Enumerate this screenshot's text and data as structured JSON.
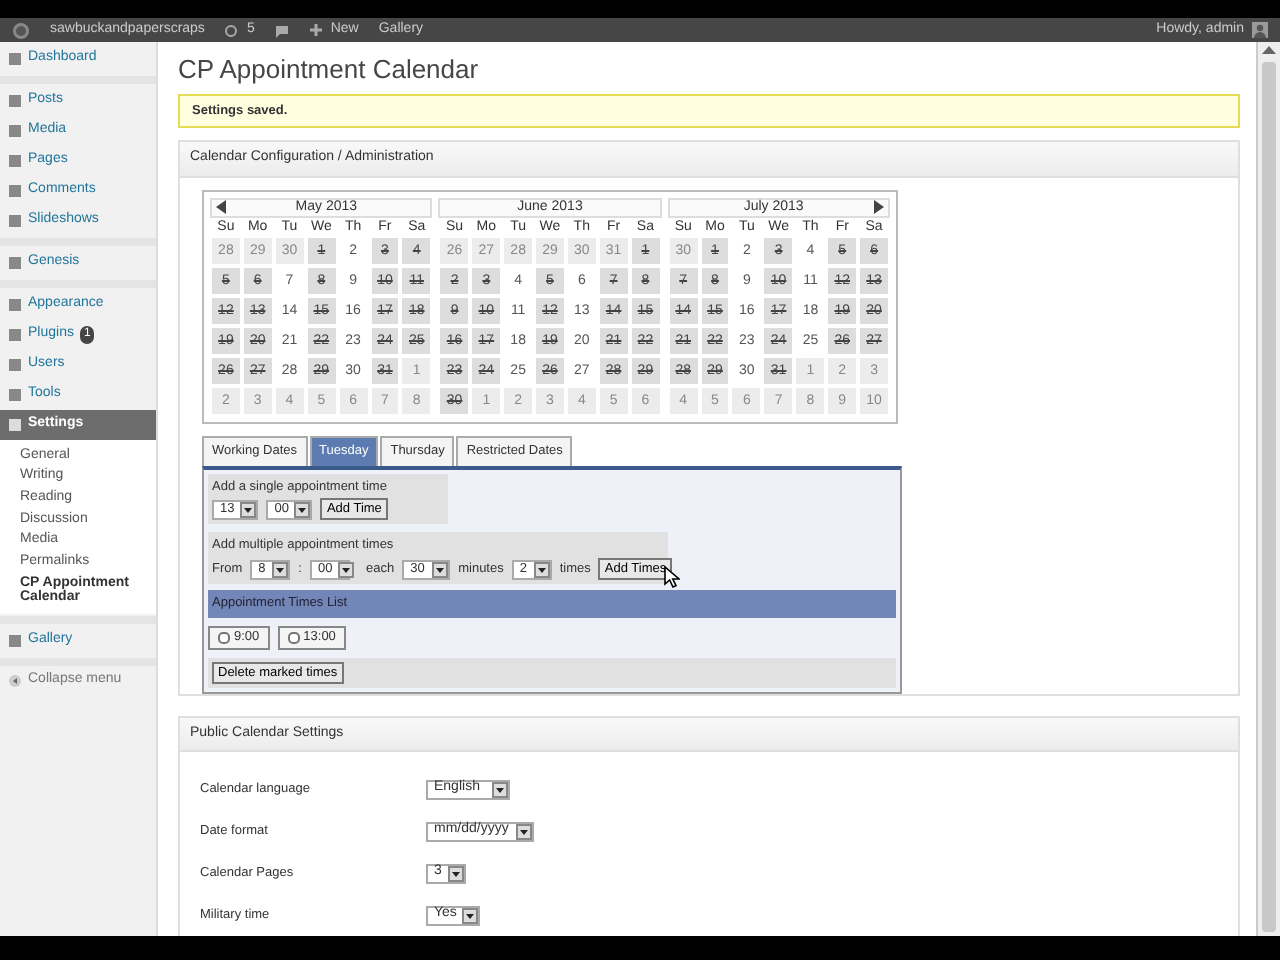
{
  "admin_bar": {
    "site_name": "sawbuckandpaperscraps",
    "updates": "5",
    "new_label": "New",
    "gallery": "Gallery",
    "greeting": "Howdy, admin"
  },
  "sidebar": {
    "groups": [
      [
        {
          "label": "Dashboard",
          "selected": false
        }
      ],
      [
        {
          "label": "Posts",
          "selected": false
        },
        {
          "label": "Media",
          "selected": false
        },
        {
          "label": "Pages",
          "selected": false
        },
        {
          "label": "Comments",
          "selected": false
        },
        {
          "label": "Slideshows",
          "selected": false
        }
      ],
      [
        {
          "label": "Genesis",
          "selected": false
        }
      ],
      [
        {
          "label": "Appearance",
          "selected": false
        },
        {
          "label": "Plugins",
          "selected": false,
          "badge": "1"
        },
        {
          "label": "Users",
          "selected": false
        },
        {
          "label": "Tools",
          "selected": false
        },
        {
          "label": "Settings",
          "selected": true,
          "children": [
            {
              "label": "General",
              "selected": false
            },
            {
              "label": "Writing",
              "selected": false
            },
            {
              "label": "Reading",
              "selected": false
            },
            {
              "label": "Discussion",
              "selected": false
            },
            {
              "label": "Media",
              "selected": false
            },
            {
              "label": "Permalinks",
              "selected": false
            },
            {
              "label": "CP Appointment Calendar",
              "selected": true
            }
          ]
        }
      ],
      [
        {
          "label": "Gallery",
          "selected": false
        }
      ]
    ],
    "collapse": "Collapse menu"
  },
  "page": {
    "title": "CP Appointment Calendar",
    "notice": "Settings saved.",
    "config_title": "Calendar Configuration / Administration"
  },
  "calendar": {
    "months": [
      {
        "title": "May 2013",
        "weekdays": [
          "Su",
          "Mo",
          "Tu",
          "We",
          "Th",
          "Fr",
          "Sa"
        ],
        "weeks": [
          [
            {
              "day": "28",
              "blocked": false,
              "outside_month": true
            },
            {
              "day": "29",
              "blocked": false,
              "outside_month": true
            },
            {
              "day": "30",
              "blocked": false,
              "outside_month": true
            },
            {
              "day": "1",
              "blocked": true,
              "outside_month": false
            },
            {
              "day": "2",
              "blocked": false,
              "outside_month": false
            },
            {
              "day": "3",
              "blocked": true,
              "outside_month": false
            },
            {
              "day": "4",
              "blocked": true,
              "outside_month": false
            }
          ],
          [
            {
              "day": "5",
              "blocked": true,
              "outside_month": false
            },
            {
              "day": "6",
              "blocked": true,
              "outside_month": false
            },
            {
              "day": "7",
              "blocked": false,
              "outside_month": false
            },
            {
              "day": "8",
              "blocked": true,
              "outside_month": false
            },
            {
              "day": "9",
              "blocked": false,
              "outside_month": false
            },
            {
              "day": "10",
              "blocked": true,
              "outside_month": false
            },
            {
              "day": "11",
              "blocked": true,
              "outside_month": false
            }
          ],
          [
            {
              "day": "12",
              "blocked": true,
              "outside_month": false
            },
            {
              "day": "13",
              "blocked": true,
              "outside_month": false
            },
            {
              "day": "14",
              "blocked": false,
              "outside_month": false
            },
            {
              "day": "15",
              "blocked": true,
              "outside_month": false
            },
            {
              "day": "16",
              "blocked": false,
              "outside_month": false
            },
            {
              "day": "17",
              "blocked": true,
              "outside_month": false
            },
            {
              "day": "18",
              "blocked": true,
              "outside_month": false
            }
          ],
          [
            {
              "day": "19",
              "blocked": true,
              "outside_month": false
            },
            {
              "day": "20",
              "blocked": true,
              "outside_month": false
            },
            {
              "day": "21",
              "blocked": false,
              "outside_month": false
            },
            {
              "day": "22",
              "blocked": true,
              "outside_month": false
            },
            {
              "day": "23",
              "blocked": false,
              "outside_month": false
            },
            {
              "day": "24",
              "blocked": true,
              "outside_month": false
            },
            {
              "day": "25",
              "blocked": true,
              "outside_month": false
            }
          ],
          [
            {
              "day": "26",
              "blocked": true,
              "outside_month": false
            },
            {
              "day": "27",
              "blocked": true,
              "outside_month": false
            },
            {
              "day": "28",
              "blocked": false,
              "outside_month": false
            },
            {
              "day": "29",
              "blocked": true,
              "outside_month": false
            },
            {
              "day": "30",
              "blocked": false,
              "outside_month": false
            },
            {
              "day": "31",
              "blocked": true,
              "outside_month": false
            },
            {
              "day": "1",
              "blocked": false,
              "outside_month": true
            }
          ],
          [
            {
              "day": "2",
              "blocked": false,
              "outside_month": true
            },
            {
              "day": "3",
              "blocked": false,
              "outside_month": true
            },
            {
              "day": "4",
              "blocked": false,
              "outside_month": true
            },
            {
              "day": "5",
              "blocked": false,
              "outside_month": true
            },
            {
              "day": "6",
              "blocked": false,
              "outside_month": true
            },
            {
              "day": "7",
              "blocked": false,
              "outside_month": true
            },
            {
              "day": "8",
              "blocked": false,
              "outside_month": true
            }
          ]
        ]
      },
      {
        "title": "June 2013",
        "weekdays": [
          "Su",
          "Mo",
          "Tu",
          "We",
          "Th",
          "Fr",
          "Sa"
        ],
        "weeks": [
          [
            {
              "day": "26",
              "blocked": false,
              "outside_month": true
            },
            {
              "day": "27",
              "blocked": false,
              "outside_month": true
            },
            {
              "day": "28",
              "blocked": false,
              "outside_month": true
            },
            {
              "day": "29",
              "blocked": false,
              "outside_month": true
            },
            {
              "day": "30",
              "blocked": false,
              "outside_month": true
            },
            {
              "day": "31",
              "blocked": false,
              "outside_month": true
            },
            {
              "day": "1",
              "blocked": true,
              "outside_month": false
            }
          ],
          [
            {
              "day": "2",
              "blocked": true,
              "outside_month": false
            },
            {
              "day": "3",
              "blocked": true,
              "outside_month": false
            },
            {
              "day": "4",
              "blocked": false,
              "outside_month": false
            },
            {
              "day": "5",
              "blocked": true,
              "outside_month": false
            },
            {
              "day": "6",
              "blocked": false,
              "outside_month": false
            },
            {
              "day": "7",
              "blocked": true,
              "outside_month": false
            },
            {
              "day": "8",
              "blocked": true,
              "outside_month": false
            }
          ],
          [
            {
              "day": "9",
              "blocked": true,
              "outside_month": false
            },
            {
              "day": "10",
              "blocked": true,
              "outside_month": false
            },
            {
              "day": "11",
              "blocked": false,
              "outside_month": false
            },
            {
              "day": "12",
              "blocked": true,
              "outside_month": false
            },
            {
              "day": "13",
              "blocked": false,
              "outside_month": false
            },
            {
              "day": "14",
              "blocked": true,
              "outside_month": false
            },
            {
              "day": "15",
              "blocked": true,
              "outside_month": false
            }
          ],
          [
            {
              "day": "16",
              "blocked": true,
              "outside_month": false
            },
            {
              "day": "17",
              "blocked": true,
              "outside_month": false
            },
            {
              "day": "18",
              "blocked": false,
              "outside_month": false
            },
            {
              "day": "19",
              "blocked": true,
              "outside_month": false
            },
            {
              "day": "20",
              "blocked": false,
              "outside_month": false
            },
            {
              "day": "21",
              "blocked": true,
              "outside_month": false
            },
            {
              "day": "22",
              "blocked": true,
              "outside_month": false
            }
          ],
          [
            {
              "day": "23",
              "blocked": true,
              "outside_month": false
            },
            {
              "day": "24",
              "blocked": true,
              "outside_month": false
            },
            {
              "day": "25",
              "blocked": false,
              "outside_month": false
            },
            {
              "day": "26",
              "blocked": true,
              "outside_month": false
            },
            {
              "day": "27",
              "blocked": false,
              "outside_month": false
            },
            {
              "day": "28",
              "blocked": true,
              "outside_month": false
            },
            {
              "day": "29",
              "blocked": true,
              "outside_month": false
            }
          ],
          [
            {
              "day": "30",
              "blocked": true,
              "outside_month": false
            },
            {
              "day": "1",
              "blocked": false,
              "outside_month": true
            },
            {
              "day": "2",
              "blocked": false,
              "outside_month": true
            },
            {
              "day": "3",
              "blocked": false,
              "outside_month": true
            },
            {
              "day": "4",
              "blocked": false,
              "outside_month": true
            },
            {
              "day": "5",
              "blocked": false,
              "outside_month": true
            },
            {
              "day": "6",
              "blocked": false,
              "outside_month": true
            }
          ]
        ]
      },
      {
        "title": "July 2013",
        "weekdays": [
          "Su",
          "Mo",
          "Tu",
          "We",
          "Th",
          "Fr",
          "Sa"
        ],
        "weeks": [
          [
            {
              "day": "30",
              "blocked": false,
              "outside_month": true
            },
            {
              "day": "1",
              "blocked": true,
              "outside_month": false
            },
            {
              "day": "2",
              "blocked": false,
              "outside_month": false
            },
            {
              "day": "3",
              "blocked": true,
              "outside_month": false
            },
            {
              "day": "4",
              "blocked": false,
              "outside_month": false
            },
            {
              "day": "5",
              "blocked": true,
              "outside_month": false
            },
            {
              "day": "6",
              "blocked": true,
              "outside_month": false
            }
          ],
          [
            {
              "day": "7",
              "blocked": true,
              "outside_month": false
            },
            {
              "day": "8",
              "blocked": true,
              "outside_month": false
            },
            {
              "day": "9",
              "blocked": false,
              "outside_month": false
            },
            {
              "day": "10",
              "blocked": true,
              "outside_month": false
            },
            {
              "day": "11",
              "blocked": false,
              "outside_month": false
            },
            {
              "day": "12",
              "blocked": true,
              "outside_month": false
            },
            {
              "day": "13",
              "blocked": true,
              "outside_month": false
            }
          ],
          [
            {
              "day": "14",
              "blocked": true,
              "outside_month": false
            },
            {
              "day": "15",
              "blocked": true,
              "outside_month": false
            },
            {
              "day": "16",
              "blocked": false,
              "outside_month": false
            },
            {
              "day": "17",
              "blocked": true,
              "outside_month": false
            },
            {
              "day": "18",
              "blocked": false,
              "outside_month": false
            },
            {
              "day": "19",
              "blocked": true,
              "outside_month": false
            },
            {
              "day": "20",
              "blocked": true,
              "outside_month": false
            }
          ],
          [
            {
              "day": "21",
              "blocked": true,
              "outside_month": false
            },
            {
              "day": "22",
              "blocked": true,
              "outside_month": false
            },
            {
              "day": "23",
              "blocked": false,
              "outside_month": false
            },
            {
              "day": "24",
              "blocked": true,
              "outside_month": false
            },
            {
              "day": "25",
              "blocked": false,
              "outside_month": false
            },
            {
              "day": "26",
              "blocked": true,
              "outside_month": false
            },
            {
              "day": "27",
              "blocked": true,
              "outside_month": false
            }
          ],
          [
            {
              "day": "28",
              "blocked": true,
              "outside_month": false
            },
            {
              "day": "29",
              "blocked": true,
              "outside_month": false
            },
            {
              "day": "30",
              "blocked": false,
              "outside_month": false
            },
            {
              "day": "31",
              "blocked": true,
              "outside_month": false
            },
            {
              "day": "1",
              "blocked": false,
              "outside_month": true
            },
            {
              "day": "2",
              "blocked": false,
              "outside_month": true
            },
            {
              "day": "3",
              "blocked": false,
              "outside_month": true
            }
          ],
          [
            {
              "day": "4",
              "blocked": false,
              "outside_month": true
            },
            {
              "day": "5",
              "blocked": false,
              "outside_month": true
            },
            {
              "day": "6",
              "blocked": false,
              "outside_month": true
            },
            {
              "day": "7",
              "blocked": false,
              "outside_month": true
            },
            {
              "day": "8",
              "blocked": false,
              "outside_month": true
            },
            {
              "day": "9",
              "blocked": false,
              "outside_month": true
            },
            {
              "day": "10",
              "blocked": false,
              "outside_month": true
            }
          ]
        ]
      }
    ]
  },
  "tabs": [
    {
      "label": "Working Dates",
      "selected": false
    },
    {
      "label": "Tuesday",
      "selected": true
    },
    {
      "label": "Thursday",
      "selected": false
    },
    {
      "label": "Restricted Dates",
      "selected": false
    }
  ],
  "single": {
    "label": "Add a single appointment time",
    "hour": "13",
    "minute": "00",
    "button": "Add Time"
  },
  "multiple": {
    "label": "Add multiple appointment times",
    "from_label": "From",
    "hour": "8",
    "separator": ":",
    "minute": "00",
    "each_label": "each",
    "interval": "30",
    "minutes_label": "minutes",
    "count": "2",
    "times_label": "times",
    "button": "Add Times"
  },
  "times_list": {
    "header": "Appointment Times List",
    "times": [
      {
        "label": "9:00",
        "checked": false
      },
      {
        "label": "13:00",
        "checked": false
      }
    ],
    "delete_button": "Delete marked times"
  },
  "public_settings": {
    "title": "Public Calendar Settings",
    "rows": [
      {
        "label": "Calendar language",
        "value": "English"
      },
      {
        "label": "Date format",
        "value": "mm/dd/yyyy"
      },
      {
        "label": "Calendar Pages",
        "value": "3"
      },
      {
        "label": "Military time",
        "value": "Yes"
      }
    ]
  }
}
